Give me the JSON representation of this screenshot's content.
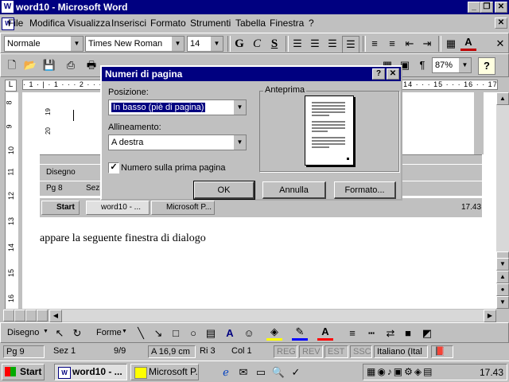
{
  "window": {
    "title": "word10 - Microsoft Word",
    "minimize": "_",
    "restore": "❐",
    "close": "✕"
  },
  "menu": {
    "items": [
      "File",
      "Modifica",
      "Visualizza",
      "Inserisci",
      "Formato",
      "Strumenti",
      "Tabella",
      "Finestra",
      "?"
    ],
    "doc_close": "✕"
  },
  "format_toolbar": {
    "style": "Normale",
    "font": "Times New Roman",
    "size": "14",
    "bold": "G",
    "italic": "C",
    "underline": "S"
  },
  "standard_toolbar": {
    "zoom": "87%",
    "help": "?"
  },
  "ruler": {
    "marks": "· 1 · | · 1 · · · 2 · · · 3 · · · 4 · · · 5 · · · 6 · · · 7 · · · 8 · · · 9 · · · 10 · · · 11 · · · 12 · · · 13 · · · 14 · · · 15 · · · 16 · · 17"
  },
  "vertical_ruler": [
    "8",
    "9",
    "10",
    "11",
    "12",
    "13",
    "14",
    "15",
    "16"
  ],
  "document": {
    "text": "appare la seguente finestra di dialogo"
  },
  "ghost": {
    "draw_label": "Disegno",
    "status_pg": "Pg 8",
    "status_sez": "Sez",
    "start": "Start",
    "task1": "word10 - ...",
    "task2": "Microsoft P...",
    "clock": "17.43",
    "ruler_left": "1 · |",
    "ruler_nums": [
      "19",
      "20"
    ]
  },
  "drawing_toolbar": {
    "draw": "Disegno",
    "shapes": "Forme"
  },
  "status": {
    "page": "Pg 9",
    "section": "Sez 1",
    "pages": "9/9",
    "position": "A 16,9 cm",
    "line": "Ri 3",
    "col": "Col 1",
    "rec": "REG",
    "rev": "REV",
    "ext": "EST",
    "ovr": "SSC",
    "lang": "Italiano (Ital"
  },
  "taskbar": {
    "start": "Start",
    "task1": "word10 - ...",
    "task2": "Microsoft P...",
    "clock": "17.43"
  },
  "dialog": {
    "title": "Numeri di pagina",
    "help": "?",
    "close": "✕",
    "position_label": "Posizione:",
    "position_value": "In basso (piè di pagina)",
    "alignment_label": "Allineamento:",
    "alignment_value": "A destra",
    "checkbox_label": "Numero sulla prima pagina",
    "checkbox_checked": "✓",
    "preview_label": "Anteprima",
    "ok": "OK",
    "cancel": "Annulla",
    "format": "Formato..."
  }
}
